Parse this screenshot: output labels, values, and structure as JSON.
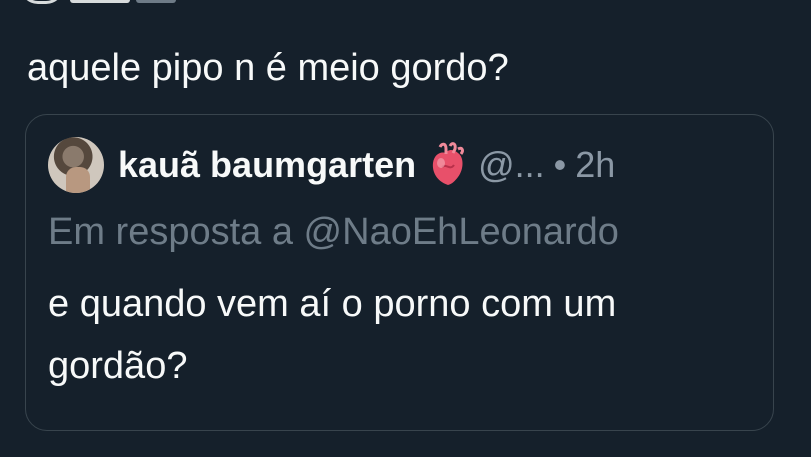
{
  "tweet": {
    "text": "aquele pipo n é meio gordo?"
  },
  "quote": {
    "author_name": "kauã baumgarten",
    "author_handle": "@...",
    "separator": "•",
    "time": "2h",
    "reply_to": "Em resposta a @NaoEhLeonardo",
    "body": "e quando vem aí o porno com um gordão?",
    "badge_icon": "anatomical-heart-icon"
  },
  "colors": {
    "background": "#15202b",
    "text_primary": "#f7f9f9",
    "text_secondary": "#8b98a5",
    "border": "#38444d"
  }
}
